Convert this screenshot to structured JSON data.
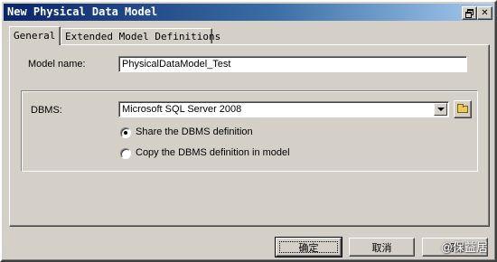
{
  "window": {
    "title": "New Physical Data Model"
  },
  "tabs": [
    {
      "label": "General",
      "active": true
    },
    {
      "label": "Extended Model Definitions",
      "active": false
    }
  ],
  "model_name": {
    "label": "Model name:",
    "value": "PhysicalDataModel_Test"
  },
  "dbms": {
    "label": "DBMS:",
    "selected": "Microsoft SQL Server 2008",
    "options": [
      {
        "label": "Share the DBMS definition",
        "checked": true
      },
      {
        "label": "Copy the DBMS definition in model",
        "checked": false
      }
    ]
  },
  "buttons": {
    "ok": "确定",
    "cancel": "取消",
    "help": "帮助"
  },
  "watermark": "@保益居",
  "icons": {
    "restore": "restore-icon",
    "close": "close-icon",
    "browse": "folder-icon",
    "dropdown": "chevron-down-icon"
  }
}
